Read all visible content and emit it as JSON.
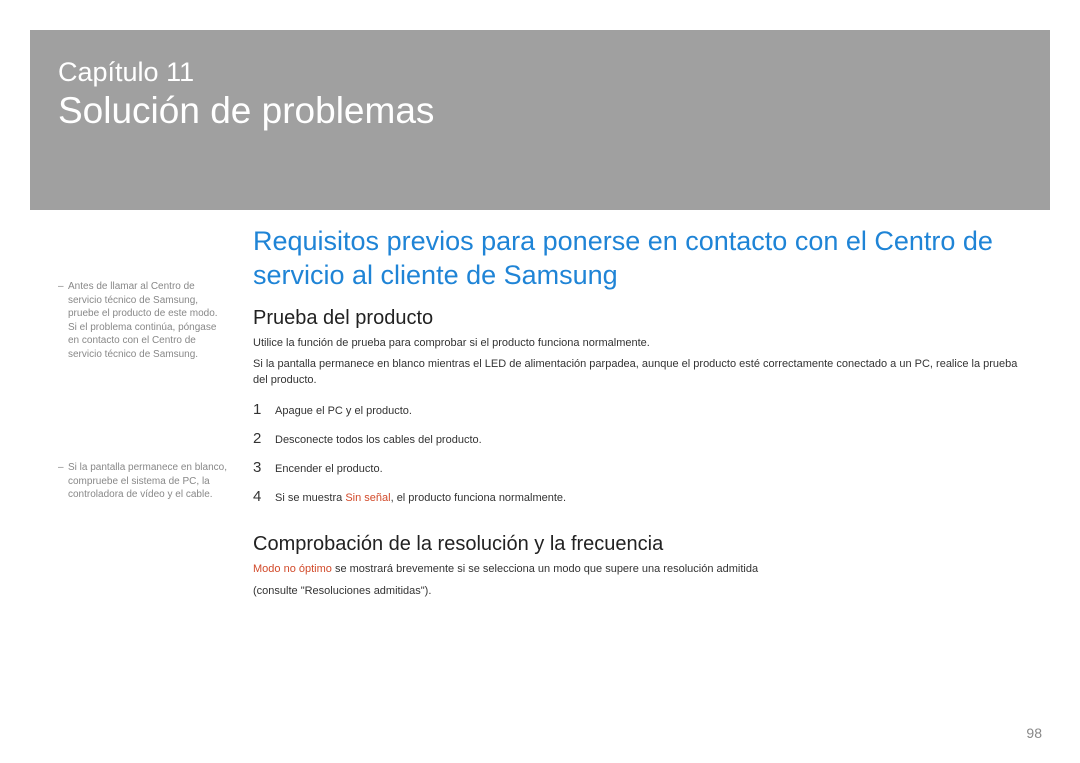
{
  "header": {
    "chapter_label": "Capítulo 11",
    "chapter_title": "Solución de problemas"
  },
  "side_notes": [
    "Antes de llamar al Centro de servicio técnico de Samsung, pruebe el producto de este modo. Si el problema continúa, póngase en contacto con el Centro de servicio técnico de Samsung.",
    "Si la pantalla permanece en blanco, compruebe el sistema de PC, la controladora de vídeo y el cable."
  ],
  "main": {
    "h1": "Requisitos previos para ponerse en contacto con el Centro de servicio al cliente de Samsung",
    "section1": {
      "h2": "Prueba del producto",
      "p1": "Utilice la función de prueba para comprobar si el producto funciona normalmente.",
      "p2": "Si la pantalla permanece en blanco mientras el LED de alimentación parpadea, aunque el producto esté correctamente conectado a un PC, realice la prueba del producto.",
      "steps": [
        "Apague el PC y el producto.",
        "Desconecte todos los cables del producto.",
        "Encender el producto."
      ],
      "step4_prefix": "Si se muestra ",
      "step4_red": "Sin señal",
      "step4_suffix": ", el producto funciona normalmente."
    },
    "section2": {
      "h2": "Comprobación de la resolución y la frecuencia",
      "p1_red": "Modo no óptimo",
      "p1_rest": " se mostrará brevemente si se selecciona un modo que supere una resolución admitida",
      "p2": "(consulte \"Resoluciones admitidas\")."
    }
  },
  "page_number": "98"
}
